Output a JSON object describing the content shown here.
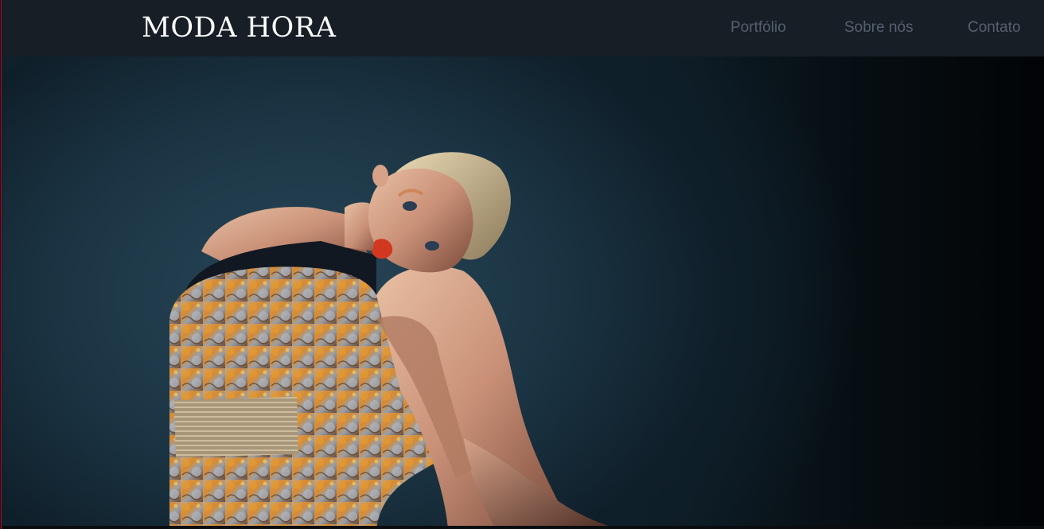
{
  "brand": {
    "logo_text": "MODA HORA"
  },
  "nav": {
    "items": [
      {
        "label": "Portfólio"
      },
      {
        "label": "Sobre nós"
      },
      {
        "label": "Contato"
      }
    ]
  },
  "hero": {
    "image_subject": "fashion-model-photo"
  },
  "colors": {
    "header_bg": "#171e26",
    "nav_text": "#55606e",
    "logo_text": "#ffffff",
    "hero_bg": "#1b3443"
  }
}
